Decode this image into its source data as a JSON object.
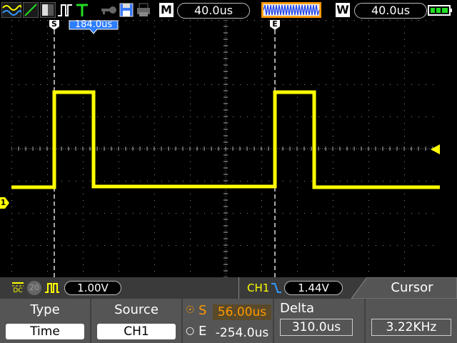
{
  "top_bar": {
    "timebase_mode_label": "M",
    "timebase": "40.0us",
    "window_label": "W",
    "window_timebase": "40.0us"
  },
  "cursors": {
    "start_marker": "S",
    "end_marker": "E",
    "position_readout": "184.0us"
  },
  "channel_bar": {
    "coupling": "DC",
    "bandwidth_limit": "20",
    "volts_per_div": "1.00V",
    "trigger_source": "CH1",
    "trigger_level": "1.44V",
    "channel_marker": "1"
  },
  "menu": {
    "title": "Cursor",
    "type_label": "Type",
    "type_value": "Time",
    "source_label": "Source",
    "source_value": "CH1",
    "s_label": "S",
    "s_value": "56.00us",
    "e_label": "E",
    "e_value": "-254.0us",
    "delta_label": "Delta",
    "delta_value": "310.0us",
    "freq_value": "3.22KHz"
  },
  "colors": {
    "trace": "#ffff00",
    "cursor_readout_bg": "#2d7dff",
    "battery": "#22dd22",
    "memory_trace": "#ff9900"
  }
}
